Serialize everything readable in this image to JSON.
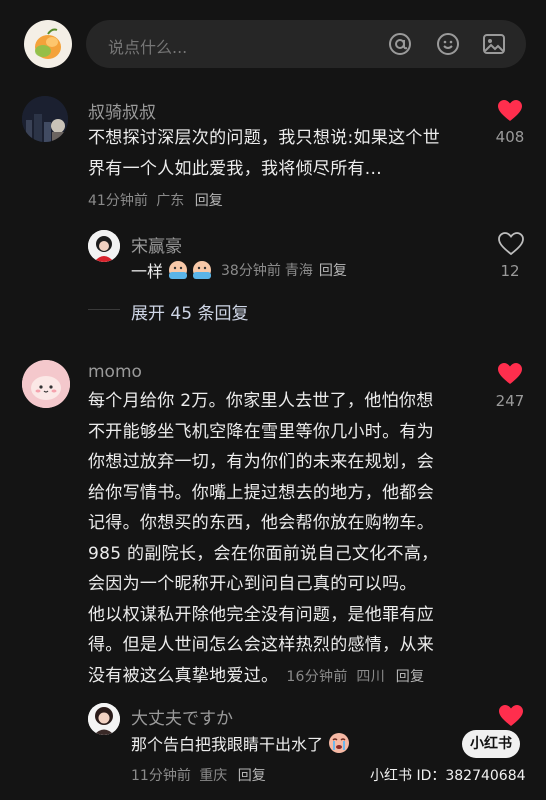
{
  "input": {
    "placeholder": "说点什么..."
  },
  "comments": [
    {
      "user": "叔骑叔叔",
      "text": [
        "不想探讨深层次的问题，我只想说:如果这个世",
        "界有一个人如此爱我，我将倾尽所有..."
      ],
      "time": "41分钟前",
      "location": "广东",
      "reply_label": "回复",
      "likes": "408",
      "liked": true,
      "replies": [
        {
          "user": "宋赢豪",
          "text": "一样",
          "time": "38分钟前",
          "location": "青海",
          "reply_label": "回复",
          "likes": "12",
          "liked": false
        }
      ],
      "expand_label": "展开 45 条回复"
    },
    {
      "user": "momo",
      "text": [
        "每个月给你 2万。你家里人去世了，他怕你想",
        "不开能够坐飞机空降在雪里等你几小时。有为",
        "你想过放弃一切，有为你们的未来在规划，会",
        "给你写情书。你嘴上提过想去的地方，他都会",
        "记得。你想买的东西，他会帮你放在购物车。",
        "985 的副院长，会在你面前说自己文化不高，",
        "会因为一个昵称开心到问自己真的可以吗。",
        "他以权谋私开除他完全没有问题，是他罪有应",
        "得。但是人世间怎么会这样热烈的感情，从来",
        "没有被这么真挚地爱过。"
      ],
      "time": "16分钟前",
      "location": "四川",
      "reply_label": "回复",
      "likes": "247",
      "liked": true,
      "replies": [
        {
          "user": "大丈夫ですか",
          "text": "那个告白把我眼睛干出水了",
          "time": "11分钟前",
          "location": "重庆",
          "reply_label": "回复",
          "likes": "",
          "liked": true
        }
      ]
    }
  ],
  "watermark": {
    "logo": "小红书",
    "id_text": "小红书 ID：382740684"
  },
  "colors": {
    "background": "#141414",
    "heart_liked": "#ff2e4d",
    "input_bg": "#262626"
  },
  "icons": [
    "mango-avatar",
    "at-icon",
    "emoji-icon",
    "image-icon",
    "heart-icon",
    "heart-outline-icon",
    "sweat-emoji",
    "crying-emoji"
  ]
}
